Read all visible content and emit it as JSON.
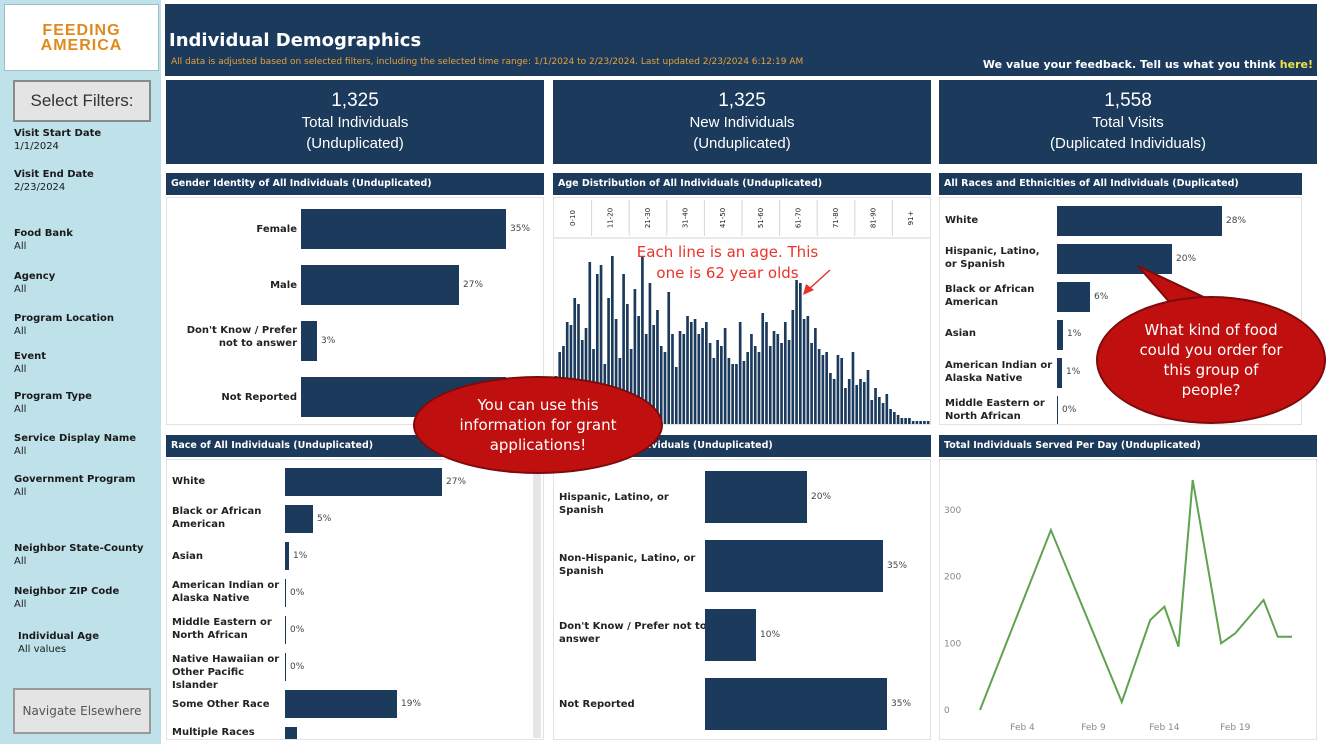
{
  "logo": {
    "line1": "FEEDING",
    "line2": "AMERICA"
  },
  "sidebar": {
    "select_filters": "Select Filters:",
    "filters": [
      {
        "title": "Visit Start Date",
        "value": "1/1/2024"
      },
      {
        "title": "Visit End Date",
        "value": "2/23/2024"
      },
      {
        "title": "Food Bank",
        "value": "All"
      },
      {
        "title": "Agency",
        "value": "All"
      },
      {
        "title": "Program Location",
        "value": "All"
      },
      {
        "title": "Event",
        "value": "All"
      },
      {
        "title": "Program Type",
        "value": "All"
      },
      {
        "title": "Service Display Name",
        "value": "All"
      },
      {
        "title": "Government Program",
        "value": "All"
      },
      {
        "title": "Neighbor State-County",
        "value": "All"
      },
      {
        "title": "Neighbor ZIP Code",
        "value": "All"
      },
      {
        "title": "Individual Age",
        "value": "All values"
      }
    ],
    "navigate": "Navigate Elsewhere"
  },
  "header": {
    "title": "Individual Demographics",
    "subtitle": "All data is adjusted based on selected filters, including the selected time range:  1/1/2024 to 2/23/2024. Last updated 2/23/2024 6:12:19 AM",
    "feedback": "We value your feedback. Tell us what you think ",
    "feedback_link": "here!"
  },
  "kpis": [
    {
      "value": "1,325",
      "line1": "Total Individuals",
      "line2": "(Unduplicated)"
    },
    {
      "value": "1,325",
      "line1": "New Individuals",
      "line2": "(Unduplicated)"
    },
    {
      "value": "1,558",
      "line1": "Total Visits",
      "line2": "(Duplicated Individuals)"
    }
  ],
  "colors": {
    "navy": "#1b3a5c",
    "sidebar": "#bfe1ea",
    "line": "#5fa350",
    "callout": "#c00f0f",
    "annotation": "#e8342a",
    "subtitle": "#e6a13a"
  },
  "panels": {
    "gender": {
      "title": "Gender Identity of All Individuals (Unduplicated)",
      "items": [
        {
          "label": "Female",
          "pct": "35%",
          "value": 35
        },
        {
          "label": "Male",
          "pct": "27%",
          "value": 27
        },
        {
          "label": "Don't Know / Prefer not to answer",
          "pct": "3%",
          "value": 3
        },
        {
          "label": "Not Reported",
          "pct": "35%",
          "value": 35
        }
      ]
    },
    "age": {
      "title": "Age Distribution of All Individuals (Unduplicated)",
      "bins": [
        "0-10",
        "11-20",
        "21-30",
        "31-40",
        "41-50",
        "51-60",
        "61-70",
        "71-80",
        "81-90",
        "91+"
      ]
    },
    "all_races": {
      "title": "All Races and Ethnicities of All Individuals (Duplicated)",
      "items": [
        {
          "label": "White",
          "pct": "28%",
          "value": 28
        },
        {
          "label": "Hispanic, Latino, or Spanish",
          "pct": "20%",
          "value": 20
        },
        {
          "label": "Black or African American",
          "pct": "6%",
          "value": 6
        },
        {
          "label": "Asian",
          "pct": "1%",
          "value": 1
        },
        {
          "label": "American Indian or Alaska Native",
          "pct": "1%",
          "value": 1
        },
        {
          "label": "Middle Eastern or North African",
          "pct": "0%",
          "value": 0
        }
      ]
    },
    "race": {
      "title": "Race of All Individuals (Unduplicated)",
      "items": [
        {
          "label": "White",
          "pct": "27%",
          "value": 27
        },
        {
          "label": "Black or African American",
          "pct": "5%",
          "value": 5
        },
        {
          "label": "Asian",
          "pct": "1%",
          "value": 1
        },
        {
          "label": "American Indian or Alaska Native",
          "pct": "0%",
          "value": 0
        },
        {
          "label": "Middle Eastern or North African",
          "pct": "0%",
          "value": 0
        },
        {
          "label": "Native Hawaiian or Other Pacific Islander",
          "pct": "0%",
          "value": 0
        },
        {
          "label": "Some Other Race",
          "pct": "19%",
          "value": 19
        },
        {
          "label": "Multiple Races",
          "pct": "",
          "value": 2
        }
      ]
    },
    "ethnicity": {
      "title": "ividuals (Unduplicated)",
      "items": [
        {
          "label": "Hispanic, Latino, or Spanish",
          "pct": "20%",
          "value": 20
        },
        {
          "label": "Non-Hispanic, Latino, or Spanish",
          "pct": "35%",
          "value": 35
        },
        {
          "label": "Don't Know / Prefer not to answer",
          "pct": "10%",
          "value": 10
        },
        {
          "label": "Not Reported",
          "pct": "35%",
          "value": 35
        }
      ]
    },
    "per_day": {
      "title": "Total Individuals Served Per Day (Unduplicated)"
    }
  },
  "chart_data": [
    {
      "type": "bar",
      "orientation": "vertical",
      "x_bins": [
        "0-10",
        "11-20",
        "21-30",
        "31-40",
        "41-50",
        "51-60",
        "61-70",
        "71-80",
        "81-90",
        "91+"
      ],
      "values": [
        16,
        24,
        26,
        34,
        33,
        42,
        40,
        28,
        32,
        54,
        25,
        50,
        53,
        20,
        42,
        56,
        35,
        22,
        50,
        40,
        25,
        45,
        36,
        56,
        30,
        47,
        33,
        38,
        26,
        24,
        44,
        30,
        19,
        31,
        30,
        36,
        34,
        35,
        30,
        32,
        34,
        27,
        22,
        28,
        26,
        32,
        22,
        20,
        20,
        34,
        21,
        24,
        30,
        26,
        24,
        37,
        34,
        26,
        31,
        30,
        27,
        34,
        28,
        38,
        48,
        47,
        35,
        36,
        27,
        32,
        25,
        23,
        24,
        17,
        15,
        23,
        22,
        12,
        15,
        24,
        13,
        15,
        14,
        18,
        8,
        12,
        9,
        7,
        10,
        5,
        4,
        3,
        2,
        2,
        2,
        1,
        1,
        1,
        1,
        1
      ]
    },
    {
      "type": "line",
      "x": [
        "Feb 1",
        "Feb 6",
        "Feb 11",
        "Feb 13",
        "Feb 14",
        "Feb 15",
        "Feb 16",
        "Feb 18",
        "Feb 19",
        "Feb 21",
        "Feb 22",
        "Feb 23"
      ],
      "values": [
        0,
        270,
        12,
        135,
        155,
        95,
        345,
        100,
        115,
        165,
        110,
        110
      ],
      "xticks": [
        "Feb 4",
        "Feb 9",
        "Feb 14",
        "Feb 19"
      ],
      "yticks": [
        0,
        100,
        200,
        300
      ],
      "ylim": [
        0,
        360
      ]
    }
  ],
  "annotations": {
    "age_note_line1": "Each line is an age. This",
    "age_note_line2": "one is 62 year olds",
    "callout_grant": "You can use this information for grant applications!",
    "callout_food": "What kind of food could you order for this group of people?"
  }
}
